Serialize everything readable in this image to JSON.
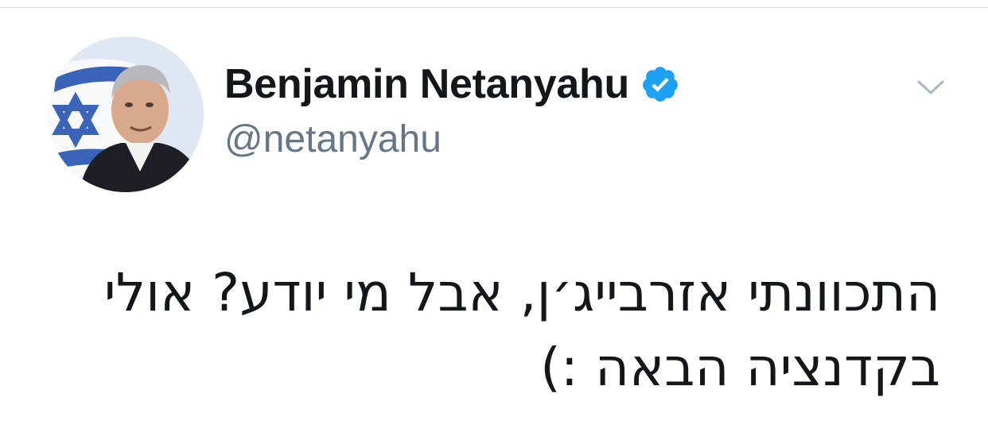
{
  "tweet": {
    "author": {
      "display_name": "Benjamin Netanyahu",
      "handle": "@netanyahu",
      "verified": true,
      "verified_icon": "verified-badge-icon",
      "avatar_icon": "avatar-photo"
    },
    "menu_icon": "chevron-down-icon",
    "text": "התכוונתי אזרבייג׳ן, אבל מי יודע? אולי\nבקדנציה הבאה :)"
  },
  "colors": {
    "name": "#14171a",
    "handle": "#657786",
    "verified": "#1da1f2",
    "caret": "#aab8c2",
    "divider": "#d9dde1"
  }
}
